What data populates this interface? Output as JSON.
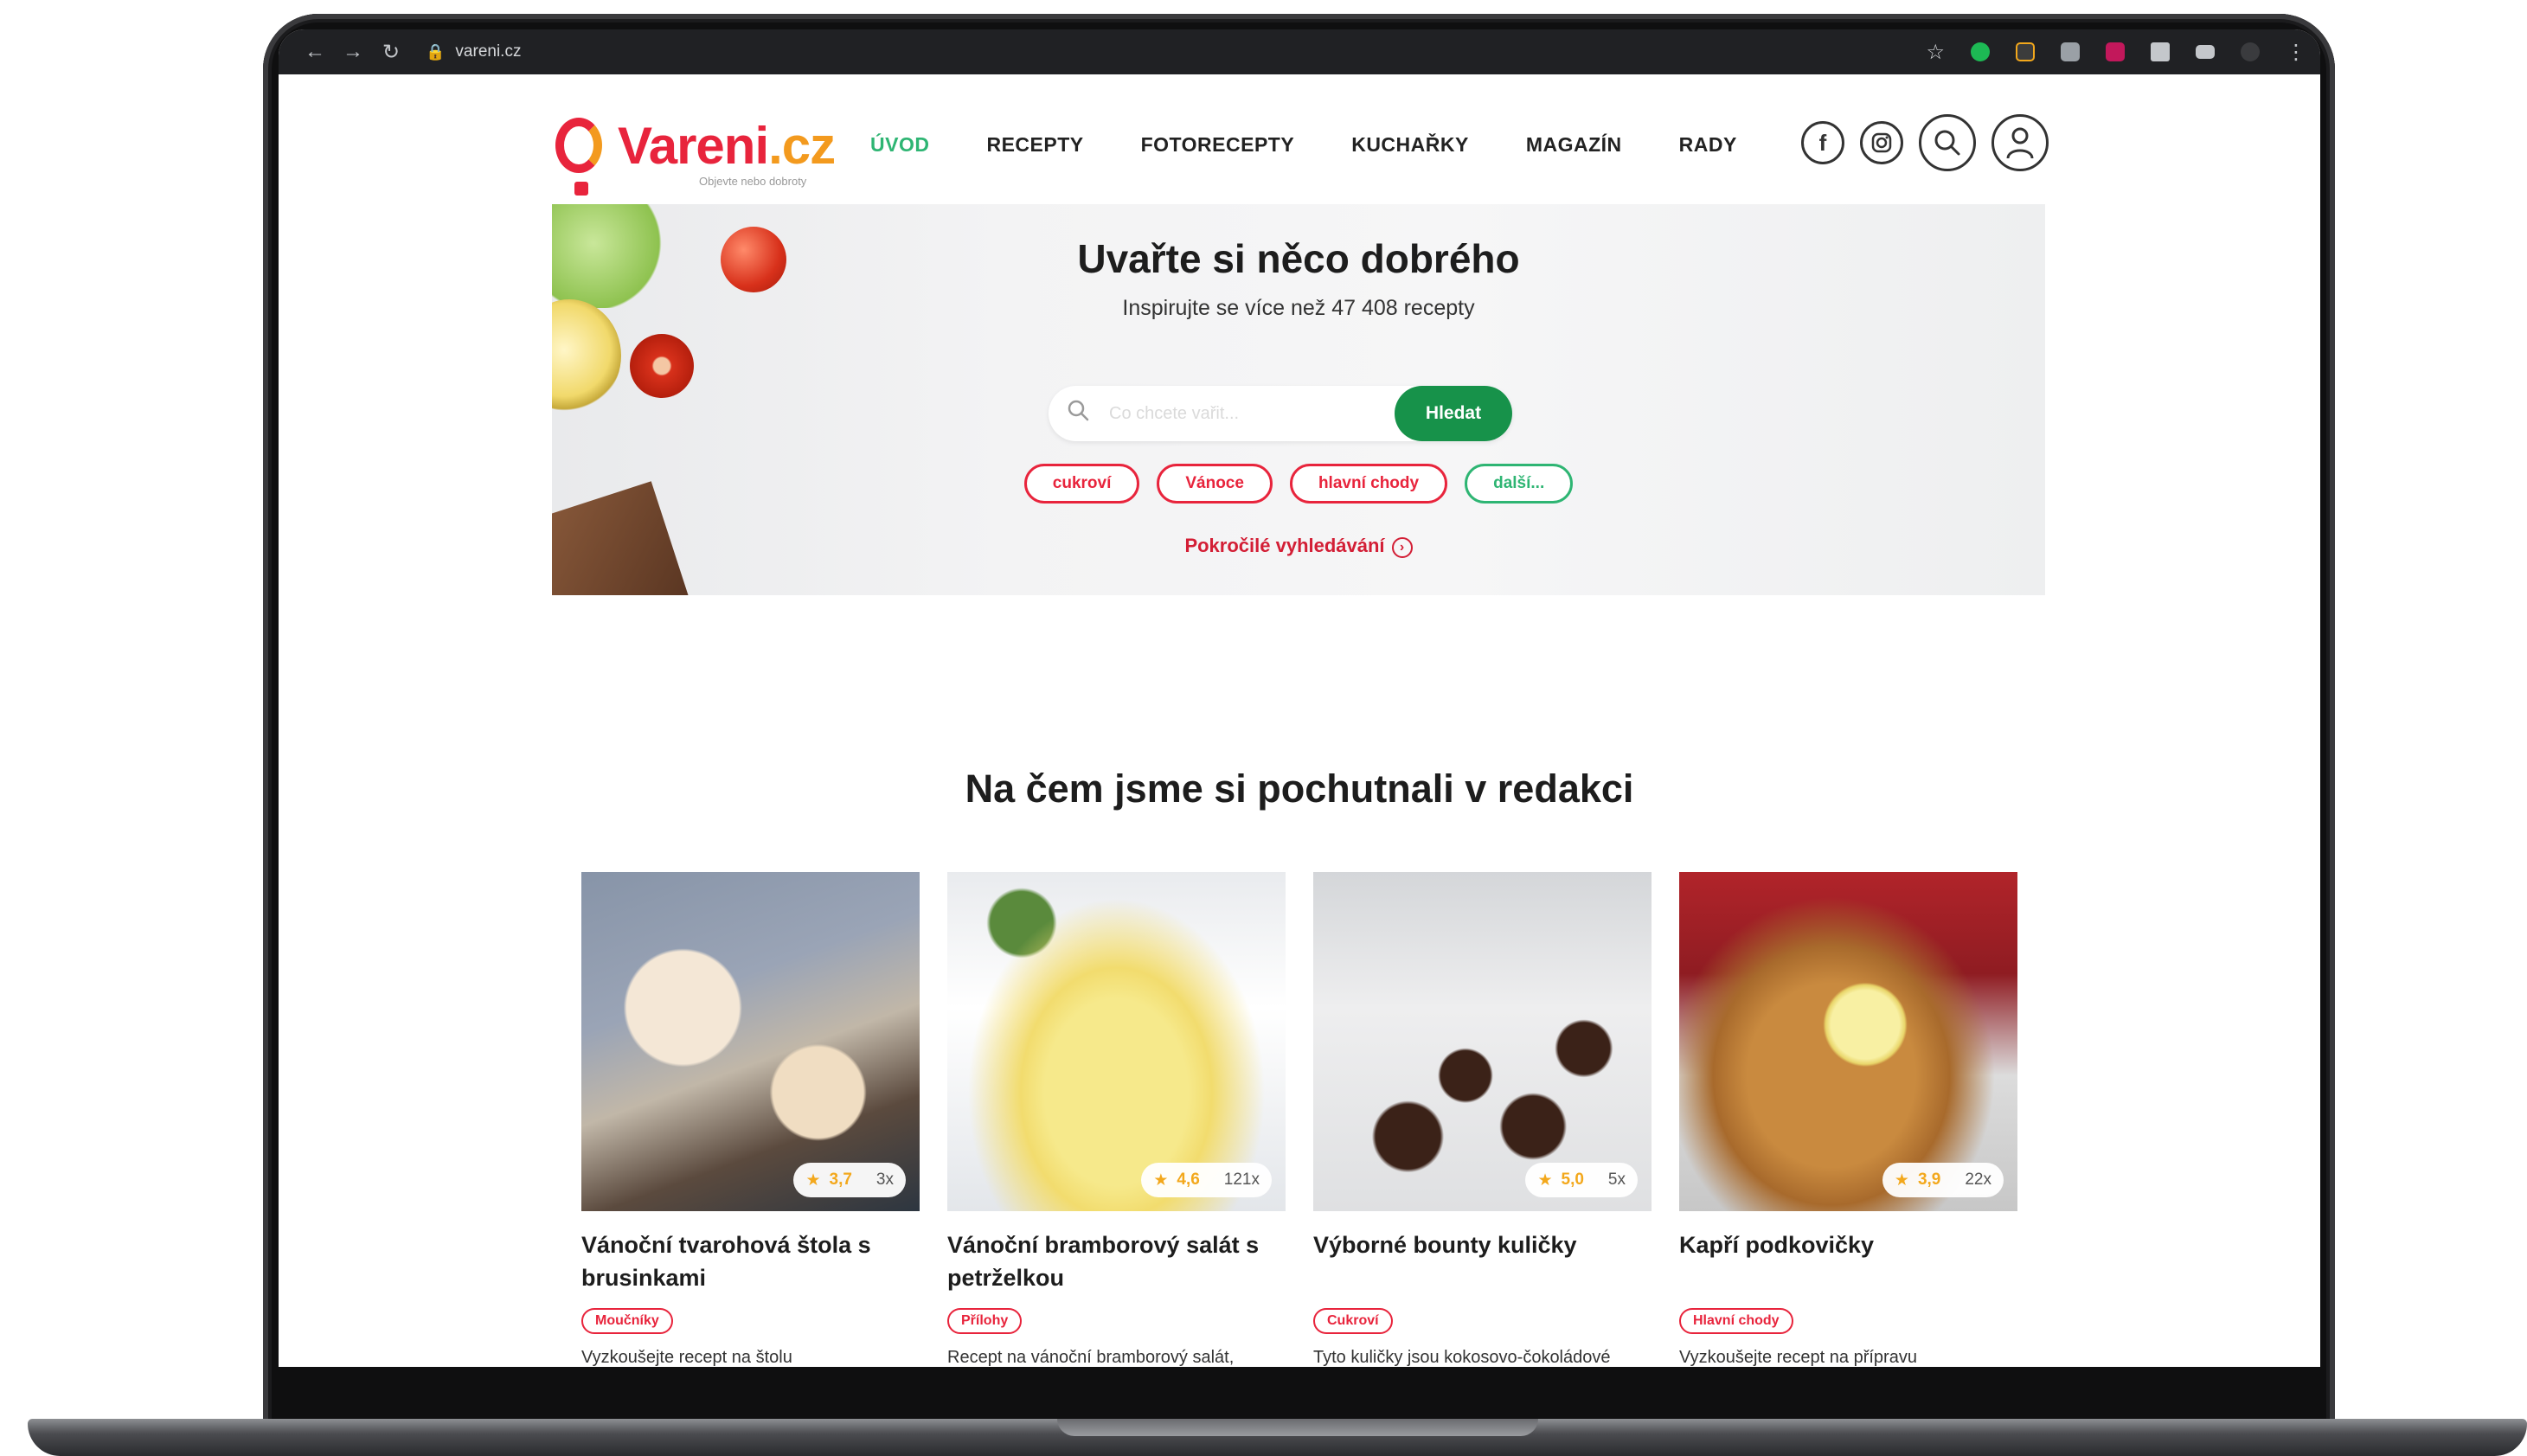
{
  "browser": {
    "url": "vareni.cz",
    "back_icon": "arrow-left",
    "forward_icon": "arrow-right",
    "reload_icon": "reload",
    "lock_icon": "lock",
    "bookmark_icon": "star",
    "menu_icon": "vertical-dots"
  },
  "header": {
    "logo_main": "Vareni",
    "logo_tld": ".cz",
    "logo_tagline": "Objevte nebo dobroty",
    "nav": [
      {
        "label": "ÚVOD",
        "active": true
      },
      {
        "label": "RECEPTY",
        "active": false
      },
      {
        "label": "FOTORECEPTY",
        "active": false
      },
      {
        "label": "KUCHAŘKY",
        "active": false
      },
      {
        "label": "MAGAZÍN",
        "active": false
      },
      {
        "label": "RADY",
        "active": false
      }
    ],
    "icons": [
      "facebook-icon",
      "instagram-icon",
      "search-icon",
      "user-icon"
    ]
  },
  "hero": {
    "title": "Uvařte si něco dobrého",
    "subtitle": "Inspirujte se více než 47 408 recepty",
    "search_placeholder": "Co chcete vařit...",
    "search_button": "Hledat",
    "tags": [
      {
        "label": "cukroví",
        "color": "red"
      },
      {
        "label": "Vánoce",
        "color": "red"
      },
      {
        "label": "hlavní chody",
        "color": "red"
      },
      {
        "label": "další...",
        "color": "green"
      }
    ],
    "advanced_search": "Pokročilé vyhledávání"
  },
  "featured": {
    "title": "Na čem jsme si pochutnali v redakci",
    "cards": [
      {
        "title": "Vánoční tvarohová štola s brusinkami",
        "rating": "3,7",
        "votes": "3x",
        "category": "Moučníky",
        "desc": "Vyzkoušejte recept na štolu"
      },
      {
        "title": "Vánoční bramborový salát s petrželkou",
        "rating": "4,6",
        "votes": "121x",
        "category": "Přílohy",
        "desc": "Recept na vánoční bramborový salát,"
      },
      {
        "title": "Výborné bounty kuličky",
        "rating": "5,0",
        "votes": "5x",
        "category": "Cukroví",
        "desc": "Tyto kuličky jsou kokosovo-čokoládové"
      },
      {
        "title": "Kapří podkovičky",
        "rating": "3,9",
        "votes": "22x",
        "category": "Hlavní chody",
        "desc": "Vyzkoušejte recept na přípravu"
      }
    ]
  },
  "colors": {
    "brand_red": "#e8243c",
    "brand_orange": "#f39a1e",
    "nav_active": "#2eb573",
    "search_button": "#17924a",
    "rating_star": "#f3a81c"
  }
}
